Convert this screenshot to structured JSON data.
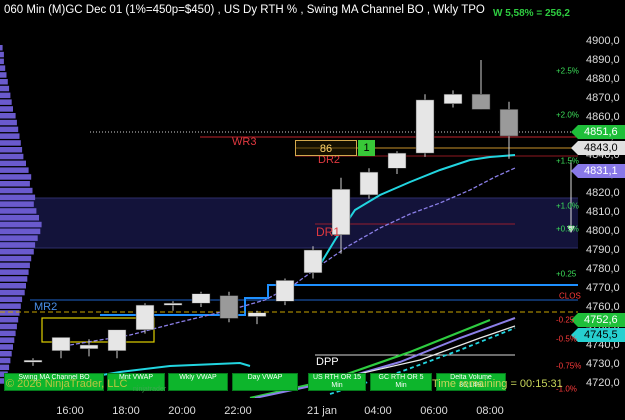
{
  "header": {
    "title": "060 Min  (M)GC Dec 01 (1%=450p=$450) , US Dy RTH % , Swing MA Channel BO , Wkly TPO",
    "gain": "W 5,58% = 256,2",
    "window_buttons": [
      "▴",
      "✕"
    ]
  },
  "price_axis": {
    "ticks": [
      "4900,0",
      "4890,0",
      "4880,0",
      "4870,0",
      "4860,0",
      "4850,0",
      "4840,0",
      "4830,0",
      "4820,0",
      "4810,0",
      "4800,0",
      "4790,0",
      "4780,0",
      "4770,0",
      "4760,0",
      "4750,0",
      "4740,0",
      "4730,0",
      "4720,0"
    ],
    "tags": [
      {
        "text": "4851,6",
        "bg": "#1fbf3a",
        "fg": "#fff"
      },
      {
        "text": "4843,0",
        "bg": "#e0e0e0",
        "fg": "#000"
      },
      {
        "text": "4831,1",
        "bg": "#8878e8",
        "fg": "#fff"
      },
      {
        "text": "4752,6",
        "bg": "#1fbf3a",
        "fg": "#fff"
      },
      {
        "text": "4745,5",
        "bg": "#26d0d0",
        "fg": "#000"
      }
    ]
  },
  "pct_axis": {
    "labels": [
      {
        "text": "+2.5%",
        "color": "#3ce05a"
      },
      {
        "text": "+2.0%",
        "color": "#3ce05a"
      },
      {
        "text": "+1.5%",
        "color": "#3ce05a"
      },
      {
        "text": "+1.0%",
        "color": "#3ce05a"
      },
      {
        "text": "+0.5%",
        "color": "#3ce05a"
      },
      {
        "text": "+0.25",
        "color": "#3ce05a"
      },
      {
        "text": "CLOS",
        "color": "#ff3b3b"
      },
      {
        "text": "-0.25",
        "color": "#ff3b3b"
      },
      {
        "text": "-0.5%",
        "color": "#ff3b3b"
      },
      {
        "text": "-0.75%",
        "color": "#ff3b3b"
      },
      {
        "text": "-1.0%",
        "color": "#ff3b3b"
      }
    ]
  },
  "time_axis": [
    "16:00",
    "18:00",
    "20:00",
    "22:00",
    "21 jan",
    "04:00",
    "06:00",
    "08:00"
  ],
  "chart_data": {
    "type": "candlestick",
    "annotations": [
      "WR3",
      "DR2",
      "DR1",
      "MR2",
      "DPP"
    ],
    "box_values": [
      "86",
      "1"
    ],
    "candles": [
      {
        "o": 4731,
        "h": 4733,
        "l": 4729,
        "c": 4732
      },
      {
        "o": 4737,
        "h": 4740,
        "l": 4733,
        "c": 4744
      },
      {
        "o": 4738,
        "h": 4743,
        "l": 4734,
        "c": 4740
      },
      {
        "o": 4737,
        "h": 4742,
        "l": 4733,
        "c": 4748
      },
      {
        "o": 4748,
        "h": 4762,
        "l": 4746,
        "c": 4761
      },
      {
        "o": 4761,
        "h": 4763,
        "l": 4758,
        "c": 4762
      },
      {
        "o": 4762,
        "h": 4768,
        "l": 4760,
        "c": 4767
      },
      {
        "o": 4766,
        "h": 4768,
        "l": 4752,
        "c": 4754
      },
      {
        "o": 4755,
        "h": 4758,
        "l": 4751,
        "c": 4757
      },
      {
        "o": 4763,
        "h": 4775,
        "l": 4761,
        "c": 4774
      },
      {
        "o": 4778,
        "h": 4792,
        "l": 4775,
        "c": 4790
      },
      {
        "o": 4798,
        "h": 4828,
        "l": 4788,
        "c": 4822
      },
      {
        "o": 4819,
        "h": 4833,
        "l": 4817,
        "c": 4831
      },
      {
        "o": 4833,
        "h": 4842,
        "l": 4830,
        "c": 4841
      },
      {
        "o": 4841,
        "h": 4872,
        "l": 4839,
        "c": 4869
      },
      {
        "o": 4867,
        "h": 4874,
        "l": 4865,
        "c": 4872
      },
      {
        "o": 4872,
        "h": 4890,
        "l": 4864,
        "c": 4864
      },
      {
        "o": 4864,
        "h": 4868,
        "l": 4838,
        "c": 4850
      }
    ]
  },
  "buttons": [
    {
      "line1": "Swing MA Channel BO",
      "line2": ""
    },
    {
      "line1": "Mnt VWAP",
      "line2": ""
    },
    {
      "line1": "Wkly VWAP",
      "line2": ""
    },
    {
      "line1": "Day VWAP",
      "line2": ""
    },
    {
      "line1": "US RTH OR 15",
      "line2": "Min"
    },
    {
      "line1": "GC RTH OR 5",
      "line2": "Min"
    },
    {
      "line1": "Delta Volume",
      "line2": "86,14%"
    }
  ],
  "footer": {
    "copyright": "© 2026 NinjaTrader, LLC",
    "timer": "Time remaining = 00:15:31",
    "watermark": "ninjatrader"
  },
  "colors": {
    "background": "#000000",
    "bull_candle": "#e6e6e6",
    "bear_candle": "#9a9a9a",
    "profile": "#6a5acd",
    "cyan_ma": "#22d5e0",
    "lavender_ma": "#8b7fe8",
    "green_ma": "#2ecc40",
    "level_blue": "#1e90ff",
    "level_red": "#c0222a"
  }
}
